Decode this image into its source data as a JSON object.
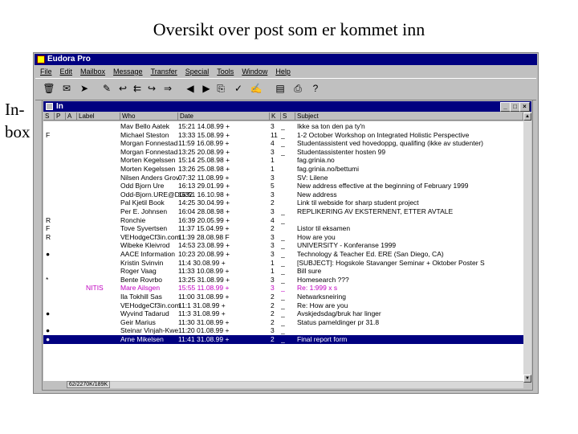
{
  "slide": {
    "title": "Oversikt over post som er kommet inn",
    "side_label_line1": "In-",
    "side_label_line2": "box"
  },
  "app": {
    "title": "Eudora Pro",
    "menu": [
      "File",
      "Edit",
      "Mailbox",
      "Message",
      "Transfer",
      "Special",
      "Tools",
      "Window",
      "Help"
    ]
  },
  "toolbar_icons": [
    "trash-icon",
    "check-mail-icon",
    "send-mail-icon",
    "new-message-icon",
    "reply-icon",
    "reply-all-icon",
    "forward-icon",
    "redirect-icon",
    "previous-message-icon",
    "next-message-icon",
    "attach-file-icon",
    "check-spelling-icon",
    "sign-icon",
    "address-book-icon",
    "print-icon",
    "help-pointer-icon"
  ],
  "mailbox": {
    "title": "In",
    "columns": {
      "flag": "S",
      "p": "P",
      "a": "A",
      "label": "Label",
      "who": "Who",
      "when": "Date",
      "s": "K",
      "sz": "S",
      "subject": "Subject"
    },
    "rows": [
      {
        "flag": "",
        "label": "",
        "who": "Mav Bello Aatek",
        "when": "15:21 14.08.99 +",
        "s": "3",
        "sz": "_",
        "subject": "Ikke sa ton den pa ty'n"
      },
      {
        "flag": "F",
        "label": "",
        "who": "Michael Steston",
        "when": "13:33 15.08.99 +",
        "s": "11",
        "sz": "_",
        "subject": "1-2 October Workshop on Integrated Holistic Perspective"
      },
      {
        "flag": "",
        "label": "",
        "who": "Morgan Fonnestad",
        "when": "11:59 16.08.99 +",
        "s": "4",
        "sz": "_",
        "subject": "Studentassistent ved hovedoppg, qualifing (ikke av studenter)"
      },
      {
        "flag": "",
        "label": "",
        "who": "Morgan Fonnestad",
        "when": "13:25 20.08.99 +",
        "s": "3",
        "sz": "_",
        "subject": "Studentassistenter hosten 99"
      },
      {
        "flag": "",
        "label": "",
        "who": "Morten Kegelssen",
        "when": "15:14 25.08.98 +",
        "s": "1",
        "sz": "",
        "subject": "fag.grinia.no"
      },
      {
        "flag": "",
        "label": "",
        "who": "Morten Kegelssen",
        "when": "13:26 25.08.98 +",
        "s": "1",
        "sz": "",
        "subject": "fag.grinia.no/bettumi"
      },
      {
        "flag": "",
        "label": "",
        "who": "Nilsen Anders Grov",
        "when": "07:32 11.08.99 +",
        "s": "3",
        "sz": "",
        "subject": "SV: Lilene"
      },
      {
        "flag": "",
        "label": "",
        "who": "Odd Bjorn Ure",
        "when": "16:13 29.01.99 +",
        "s": "5",
        "sz": "",
        "subject": "New address effective at the beginning of February 1999"
      },
      {
        "flag": "",
        "label": "",
        "who": "Odd-Bjorn.URE@DG32",
        "when": "16:51 16.10.98 +",
        "s": "3",
        "sz": "",
        "subject": "New address"
      },
      {
        "flag": "",
        "label": "",
        "who": "Pal Kjetil Book",
        "when": "14:25 30.04.99 +",
        "s": "2",
        "sz": "",
        "subject": "Link til webside for sharp student project"
      },
      {
        "flag": "",
        "label": "",
        "who": "Per E. Johnsen",
        "when": "16:04 28.08.98 +",
        "s": "3",
        "sz": "_",
        "subject": "REPLIKERING AV EKSTERNENT, ETTER AVTALE"
      },
      {
        "flag": "R",
        "label": "",
        "who": "Ronchie",
        "when": "16:39 20.05.99 +",
        "s": "4",
        "sz": "_",
        "subject": ""
      },
      {
        "flag": "F",
        "label": "",
        "who": "Tove Syvertsen",
        "when": "11:37 15.04.99 +",
        "s": "2",
        "sz": "",
        "subject": "Listor til eksamen"
      },
      {
        "flag": "R",
        "label": "",
        "who": "VEHodgeCf3in.com",
        "when": "11:39 28.08.98 F",
        "s": "3",
        "sz": "_",
        "subject": "How are you"
      },
      {
        "flag": "",
        "label": "",
        "who": "Wibeke Kleivrod",
        "when": "14:53 23.08.99 +",
        "s": "3",
        "sz": "_",
        "subject": "UNIVERSITY - Konferanse 1999"
      },
      {
        "flag": "dot",
        "label": "",
        "who": "AACE Information",
        "when": "10:23 20.08.99 +",
        "s": "3",
        "sz": "_",
        "subject": "Technology & Teacher Ed. ERE (San Diego, CA)"
      },
      {
        "flag": "",
        "label": "",
        "who": "Kristin Svinvin",
        "when": "11:4 30.08.99 +",
        "s": "1",
        "sz": "_",
        "subject": "[SUBJECT]: Hogskole Stavanger Seminar + Oktober Poster S"
      },
      {
        "flag": "",
        "label": "",
        "who": "Roger Vaag",
        "when": "11:33 10.08.99 +",
        "s": "1",
        "sz": "_",
        "subject": "Bill sure"
      },
      {
        "flag": "*",
        "label": "",
        "who": "Bente Rovrbo",
        "when": "13:25 31.08.99 +",
        "s": "3",
        "sz": "_",
        "subject": "Homesearch ???"
      },
      {
        "flag": "",
        "label": "NITIS",
        "who": "Mare Ailsgen",
        "when": "15:55 11.08.99 +",
        "s": "3",
        "sz": "_",
        "subject": "Re: 1:999 x s",
        "unread": true
      },
      {
        "flag": "",
        "label": "",
        "who": "Ila Tokhill Sas",
        "when": "11:00 31.08.99 +",
        "s": "2",
        "sz": "_",
        "subject": "Netwarksneiring"
      },
      {
        "flag": "",
        "label": "",
        "who": "VEHodgeCf3in.com",
        "when": "11:1 31.08.99 +",
        "s": "2",
        "sz": "_",
        "subject": "Re: How are you"
      },
      {
        "flag": "dot",
        "label": "",
        "who": "Wyvind Tadarud",
        "when": "11:3 31.08.99 +",
        "s": "2",
        "sz": "_",
        "subject": "Avskjedsdag/bruk har linger"
      },
      {
        "flag": "",
        "label": "",
        "who": "Geir Marius",
        "when": "11:30 31.08.99 +",
        "s": "2",
        "sz": "_",
        "subject": "Status pameldinger pr 31.8"
      },
      {
        "flag": "dot",
        "label": "",
        "who": "Steinar Vinjah-Kwe",
        "when": "11:20 01.08.99 +",
        "s": "3",
        "sz": "_",
        "subject": ""
      },
      {
        "flag": "dot",
        "label": "",
        "who": "Arne Mikelsen",
        "when": "11:41 31.08.99 +",
        "s": "2",
        "sz": "_",
        "subject": "Final report form",
        "selected": true
      }
    ],
    "status": "62/2270K/189K"
  }
}
